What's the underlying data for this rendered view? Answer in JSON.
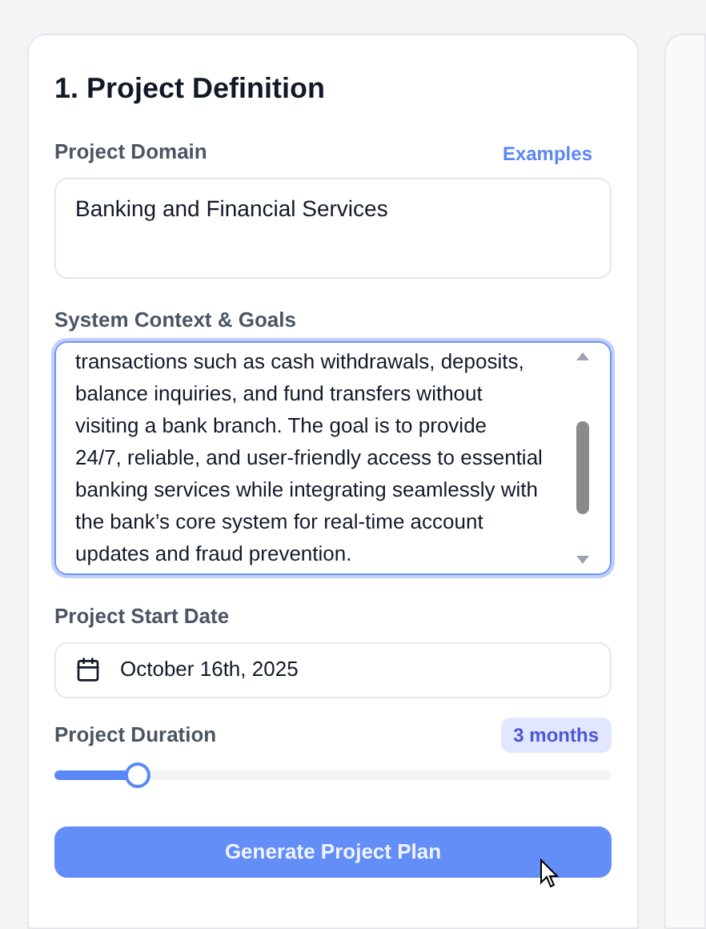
{
  "panel": {
    "title": "1. Project Definition"
  },
  "domain": {
    "label": "Project Domain",
    "link": "Examples",
    "value": "Banking and Financial Services"
  },
  "context": {
    "label": "System Context & Goals",
    "value": "transactions such as cash withdrawals, deposits,\nbalance inquiries, and fund transfers without\nvisiting a bank branch. The goal is to provide\n24/7, reliable, and user-friendly access to essential\nbanking services while integrating seamlessly with\nthe bank’s core system for real-time account\nupdates and fraud prevention.",
    "focused": true
  },
  "start_date": {
    "label": "Project Start Date",
    "value": "October 16th, 2025"
  },
  "duration": {
    "label": "Project Duration",
    "reading": "3 months",
    "level": 0.15
  },
  "button": {
    "label": "Generate Project Plan",
    "disabled": true
  }
}
